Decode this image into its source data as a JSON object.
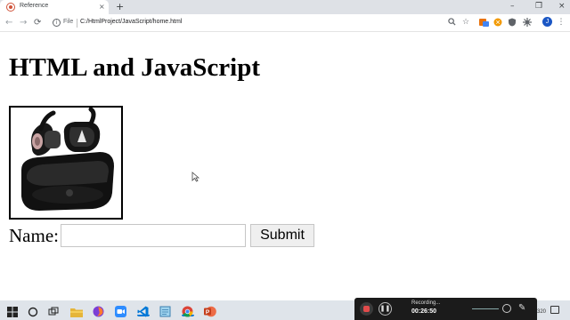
{
  "browser": {
    "tab_title": "Reference",
    "tab_close": "×",
    "new_tab": "+",
    "window_controls": {
      "minimize": "–",
      "restore": "❐",
      "close": "×"
    },
    "nav": {
      "back": "←",
      "forward": "→",
      "reload": "⟳"
    },
    "address": {
      "scheme_label": "File",
      "url": "C:/HtmlProject/JavaScript/home.html"
    },
    "profile_initial": "J",
    "icons": [
      "zoom-icon",
      "star-icon",
      "extension-icon",
      "extension-icon-2",
      "shield-icon",
      "puzzle-icon",
      "profile-avatar",
      "menu-icon"
    ]
  },
  "page": {
    "heading": "HTML and JavaScript",
    "image_alt": "black wireless earbuds in charging case",
    "form": {
      "label": "Name:",
      "input_value": "",
      "submit_label": "Submit"
    }
  },
  "recorder": {
    "status": "Recording...",
    "elapsed": "00:26:50"
  },
  "tray": {
    "clock_fragment": "320"
  },
  "colors": {
    "tabstrip": "#dee1e6",
    "taskbar": "#dfe4ea",
    "recorder_bg": "#1b1b1b",
    "record_red": "#e24b4b",
    "profile_blue": "#1a56c4"
  }
}
